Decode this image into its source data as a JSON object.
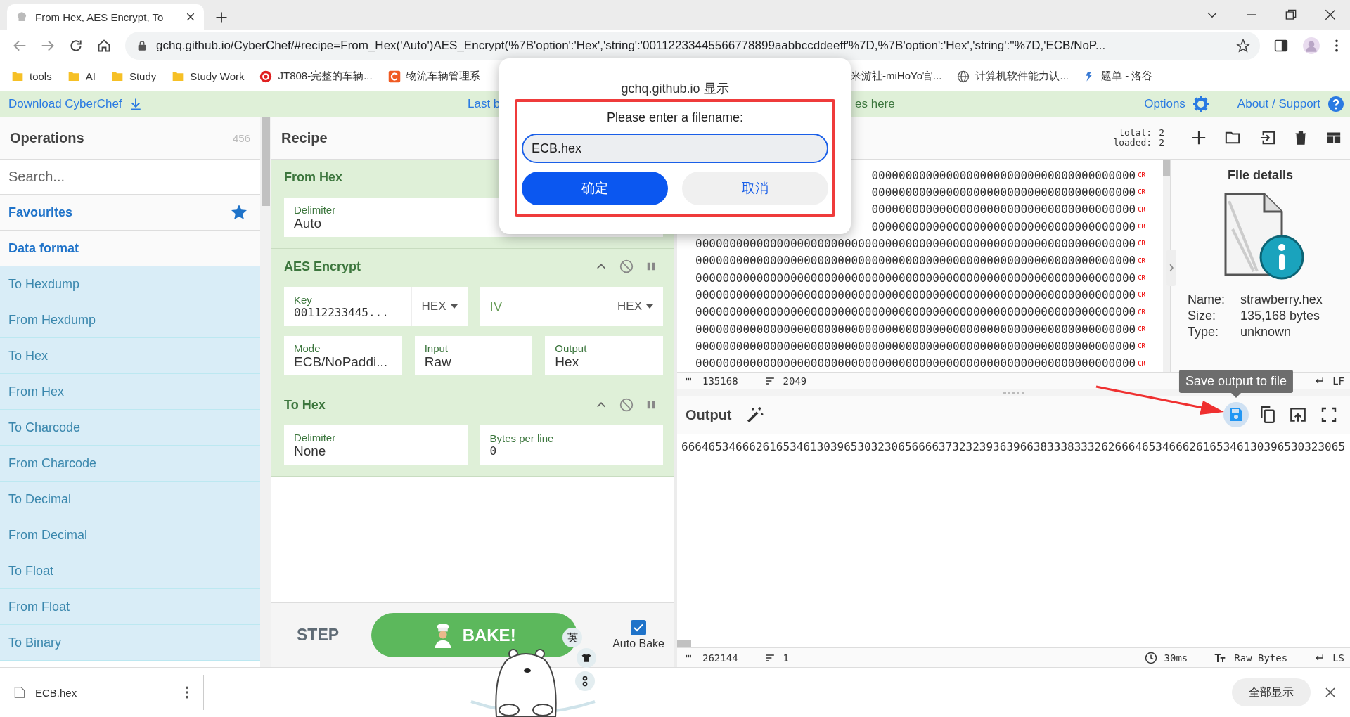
{
  "browser": {
    "tabs": [
      {
        "title": "From Hex, AES Encrypt, To",
        "selected": true
      }
    ],
    "address": "gchq.github.io/CyberChef/#recipe=From_Hex('Auto')AES_Encrypt(%7B'option':'Hex','string':'00112233445566778899aabbccddeeff'%7D,%7B'option':'Hex','string':''%7D,'ECB/NoP...",
    "bookmarks": [
      {
        "label": "tools",
        "kind": "folder",
        "partly_hidden": false
      },
      {
        "label": "AI",
        "kind": "folder",
        "partly_hidden": false
      },
      {
        "label": "Study",
        "kind": "folder",
        "partly_hidden": false
      },
      {
        "label": "Study Work",
        "kind": "folder",
        "partly_hidden": false
      },
      {
        "label": "JT808-完整的车辆...",
        "kind": "swirl",
        "partly_hidden": false
      },
      {
        "label": "物流车辆管理系",
        "kind": "square",
        "partly_hidden": false
      },
      {
        "label": "米游社-miHoYo官...",
        "partly_hidden": true
      },
      {
        "label": "计算机软件能力认...",
        "kind": "globe",
        "partly_hidden": false
      },
      {
        "label": "题单 - 洛谷",
        "kind": "luogu",
        "partly_hidden": false
      }
    ]
  },
  "banner": {
    "download": "Download CyberChef",
    "notice_start": "Last b",
    "notice_end": "es here",
    "options": "Options",
    "about": "About / Support"
  },
  "operations": {
    "title": "Operations",
    "count": "456",
    "search_placeholder": "Search...",
    "categories": [
      {
        "label": "Favourites",
        "kind": "favourites"
      },
      {
        "label": "Data format",
        "kind": "category"
      }
    ],
    "items": [
      "To Hexdump",
      "From Hexdump",
      "To Hex",
      "From Hex",
      "To Charcode",
      "From Charcode",
      "To Decimal",
      "From Decimal",
      "To Float",
      "From Float",
      "To Binary"
    ]
  },
  "recipe": {
    "title": "Recipe",
    "operations": [
      {
        "name": "From Hex",
        "args": [
          {
            "kind": "select",
            "label": "Delimiter",
            "value": "Auto"
          }
        ]
      },
      {
        "name": "AES Encrypt",
        "controls_visible": true,
        "args": [
          {
            "kind": "toggle",
            "label": "Key",
            "value": "00112233445...",
            "option": "HEX"
          },
          {
            "kind": "toggle",
            "placeholder": "IV",
            "option": "HEX"
          },
          {
            "kind": "select",
            "label": "Mode",
            "value": "ECB/NoPaddi..."
          },
          {
            "kind": "select",
            "label": "Input",
            "value": "Raw"
          },
          {
            "kind": "select",
            "label": "Output",
            "value": "Hex"
          }
        ]
      },
      {
        "name": "To Hex",
        "controls_visible": true,
        "args": [
          {
            "kind": "select",
            "label": "Delimiter",
            "value": "None"
          },
          {
            "kind": "number",
            "label": "Bytes per line",
            "value": "0"
          }
        ]
      }
    ],
    "step": "STEP",
    "bake": "BAKE!",
    "auto_bake": {
      "label": "Auto Bake",
      "checked": true
    }
  },
  "input": {
    "total_label": "total:",
    "total": "2",
    "loaded_label": "loaded:",
    "loaded": "2",
    "lines": [
      {
        "text": "000000000000000000000000000000000000000",
        "eol": "CR"
      },
      {
        "text": "000000000000000000000000000000000000000",
        "eol": "CR"
      },
      {
        "text": "000000000000000000000000000000000000000",
        "eol": "CR"
      },
      {
        "text": "000000000000000000000000000000000000000",
        "eol": "CR"
      },
      {
        "text": "00000000000000000000000000000000000000000000000000000000000000000",
        "eol": "CR"
      },
      {
        "text": "00000000000000000000000000000000000000000000000000000000000000000",
        "eol": "CR"
      },
      {
        "text": "00000000000000000000000000000000000000000000000000000000000000000",
        "eol": "CR"
      },
      {
        "text": "00000000000000000000000000000000000000000000000000000000000000000",
        "eol": "CR"
      },
      {
        "text": "00000000000000000000000000000000000000000000000000000000000000000",
        "eol": "CR"
      },
      {
        "text": "00000000000000000000000000000000000000000000000000000000000000000",
        "eol": "CR"
      },
      {
        "text": "00000000000000000000000000000000000000000000000000000000000000000",
        "eol": "CR"
      },
      {
        "text": "00000000000000000000000000000000000000000000000000000000000000000",
        "eol": "CR"
      }
    ],
    "status": {
      "chars": "135168",
      "lines": "2049",
      "eol": "LF"
    }
  },
  "file_details": {
    "title": "File details",
    "fields": [
      {
        "label": "Name:",
        "value": "strawberry.hex"
      },
      {
        "label": "Size:",
        "value": "135,168 bytes"
      },
      {
        "label": "Type:",
        "value": "unknown"
      }
    ]
  },
  "output": {
    "title": "Output",
    "text": "66646534666261653461303965303230656666373232393639663833383332626664653466626165346130396530323065",
    "tooltip": "Save output to file",
    "tools": [
      {
        "kind": "save",
        "hovered": true
      },
      {
        "kind": "copy",
        "hovered": false
      },
      {
        "kind": "open",
        "hovered": false
      },
      {
        "kind": "fullscreen",
        "hovered": false
      }
    ],
    "status": {
      "chars": "262144",
      "lines": "1",
      "time": "30ms",
      "encoding": "Raw Bytes",
      "eol": "LS"
    }
  },
  "dialog": {
    "origin": "gchq.github.io 显示",
    "message": "Please enter a filename:",
    "value": "ECB.hex",
    "ok": "确定",
    "cancel": "取消"
  },
  "widget": {
    "language": "英"
  },
  "downloads": {
    "file": "ECB.hex",
    "show_all": "全部显示"
  }
}
